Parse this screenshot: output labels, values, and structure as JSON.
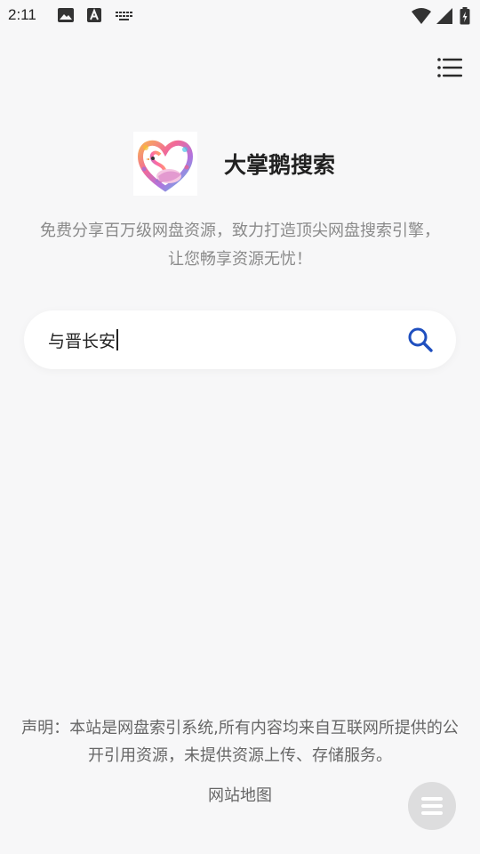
{
  "status_bar": {
    "time": "2:11",
    "icons": [
      "image-icon",
      "a-letter-icon",
      "keyboard-icon",
      "wifi-icon",
      "signal-icon",
      "battery-icon"
    ]
  },
  "header": {
    "menu_icon": "list-menu-icon"
  },
  "brand": {
    "title": "大掌鹅搜索",
    "logo_icon": "swan-heart-logo"
  },
  "tagline": "免费分享百万级网盘资源，致力打造顶尖网盘搜索引擎，让您畅享资源无忧！",
  "search": {
    "value": "与晋长安",
    "icon": "search-icon",
    "accent": "#1f4fbf"
  },
  "footer": {
    "disclaimer": "声明：本站是网盘索引系统,所有内容均来自互联网所提供的公开引用资源，未提供资源上传、存储服务。",
    "sitemap": "网站地图",
    "float_icon": "menu-float-icon"
  }
}
